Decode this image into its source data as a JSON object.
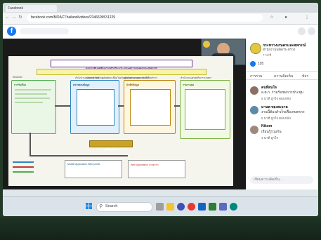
{
  "browser": {
    "tab_label": "Facebook",
    "url": "facebook.com/MOACThailand/videos/2346609531229"
  },
  "video": {
    "slide": {
      "title": "ผลการขับเคลื่อนการดำเนินงาน กระทรวงเกษตรและสหกรณ์",
      "subtitle": "นโยบาย Web Application เชื่อมโยงข้อมูลเกษตรกรและการเข้าถึงบริการ",
      "col_headers": [
        "Receiver",
        "สำนักงานเกษตรอำเภอ",
        "สำนักงานเกษตรจังหวัด",
        "สำนักงานเศรษฐกิจการเกษตร"
      ],
      "box_titles": [
        "การรับเรื่อง",
        "ตรวจสอบข้อมูล",
        "บันทึกข้อมูล",
        "รายงานผล"
      ],
      "center_label": "ฐานข้อมูลกลาง",
      "footer_left": "Mobile Application Web portal",
      "footer_right": "Web Application เกษตรกร"
    }
  },
  "page": {
    "name": "กระทรวงเกษตรและสหกรณ์",
    "subname": "สำนักงานปลัดกระทรวง",
    "time": "7 นาที",
    "reactions": "195",
    "tabs": [
      "การรวม",
      "ความคิดเห็น",
      "ข้อร"
    ]
  },
  "comments": [
    {
      "name": "คนที่สนใจ",
      "text": "อ.ต.ก. ร่วมรับชมการประชุม",
      "meta": "5 นาที  ถูกใจ  ตอบกลับ"
    },
    {
      "name": "มานพ ทองสะอาด",
      "text": "งานนี้ต้องสำเร็จเพื่อเกษตรกร",
      "meta": "5 นาที  ถูกใจ  ตอบกลับ"
    },
    {
      "name": "Nikom",
      "text": "เรียนรู้ร่วมกัน",
      "meta": "4 นาที  ถูกใจ"
    }
  ],
  "comment_input": {
    "placeholder": "เขียนความคิดเห็น..."
  },
  "taskbar": {
    "search_label": "Search"
  },
  "colors": {
    "accent": "#1877f2",
    "slide_green": "#4caf50",
    "slide_purple": "#6a2c91",
    "slide_orange": "#e67e22"
  }
}
